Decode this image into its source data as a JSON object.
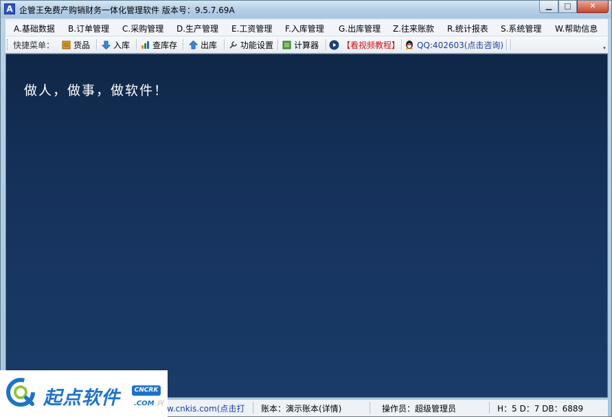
{
  "window": {
    "title": "企管王免费产购销财务一体化管理软件 版本号：9.5.7.69A",
    "app_icon": "A",
    "minimize_icon": "▁",
    "maximize_icon": "□",
    "close_icon": "✕"
  },
  "menu": {
    "items": [
      "A.基础数据",
      "B.订单管理",
      "C.采购管理",
      "D.生产管理",
      "E.工资管理",
      "F.入库管理",
      "G.出库管理",
      "Z.往来账款",
      "R.统计报表",
      "S.系统管理",
      "W.帮助信息"
    ]
  },
  "toolbar": {
    "quick_menu_label": "快捷菜单：",
    "goods": "货品",
    "stock_in": "入库",
    "check_stock": "查库存",
    "stock_out": "出库",
    "feature_settings": "功能设置",
    "calculator": "计算器",
    "video_tutorial": "【看视频教程】",
    "qq": "QQ:402603(点击咨询)",
    "overflow_icon": "▾"
  },
  "main": {
    "slogan": "做人，做事，做软件！"
  },
  "statusbar": {
    "website": "w.cnkis.com(点击打",
    "account": "账本：演示账本(详情)",
    "operator": "操作员：超级管理员",
    "db_info": "H：5 D：7 DB：6889"
  },
  "watermark": {
    "text": "起点软件",
    "badge": "CNCRK",
    "com": ".COM",
    "com_suffix": "兴"
  },
  "colors": {
    "main_bg": "#15315a",
    "accent_blue": "#1d73c9",
    "tutorial_red": "#d01010",
    "qq_blue": "#1a3ea0"
  }
}
